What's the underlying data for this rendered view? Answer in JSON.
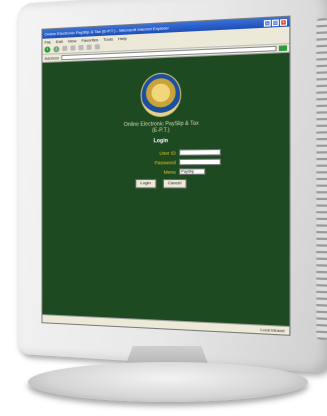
{
  "browser": {
    "title": "Online Electronic PaySlip & Tax (E-P.T.) - Microsoft Internet Explorer",
    "menu": [
      "File",
      "Edit",
      "View",
      "Favorites",
      "Tools",
      "Help"
    ],
    "address_label": "Address",
    "status": "Local intranet"
  },
  "page": {
    "org_name_line1": "Online Electronic PaySlip & Tax",
    "org_name_line2": "(E-P.T.)",
    "login_heading": "Login",
    "user_id_label": "User ID",
    "password_label": "Password",
    "menu_label": "Menu",
    "menu_selected": "PaySlip",
    "login_button": "Login",
    "cancel_button": "Cancel"
  },
  "colors": {
    "page_bg": "#1e4a22",
    "label": "#f0c419",
    "titlebar": "#1d4fb8"
  }
}
